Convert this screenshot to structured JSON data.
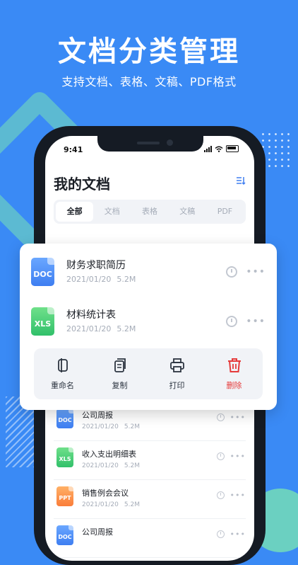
{
  "hero": {
    "title": "文档分类管理",
    "subtitle": "支持文档、表格、文稿、PDF格式"
  },
  "status": {
    "time": "9:41"
  },
  "page": {
    "title": "我的文档"
  },
  "tabs": [
    {
      "label": "全部",
      "active": true
    },
    {
      "label": "文档",
      "active": false
    },
    {
      "label": "表格",
      "active": false
    },
    {
      "label": "文稿",
      "active": false
    },
    {
      "label": "PDF",
      "active": false
    }
  ],
  "popup": {
    "files": [
      {
        "name": "财务求职简历",
        "date": "2021/01/20",
        "size": "5.2M",
        "type": "DOC"
      },
      {
        "name": "材料统计表",
        "date": "2021/01/20",
        "size": "5.2M",
        "type": "XLS"
      }
    ],
    "actions": [
      {
        "label": "重命名",
        "icon": "rename-icon"
      },
      {
        "label": "复制",
        "icon": "copy-icon"
      },
      {
        "label": "打印",
        "icon": "print-icon"
      },
      {
        "label": "删除",
        "icon": "trash-icon"
      }
    ]
  },
  "list": [
    {
      "name": "公司周报",
      "date": "2021/01/20",
      "size": "5.2M",
      "type": "DOC"
    },
    {
      "name": "收入支出明细表",
      "date": "2021/01/20",
      "size": "5.2M",
      "type": "XLS"
    },
    {
      "name": "销售例会会议",
      "date": "2021/01/20",
      "size": "5.2M",
      "type": "PPT"
    },
    {
      "name": "公司周报",
      "date": "",
      "size": "",
      "type": "DOC"
    }
  ],
  "colors": {
    "background": "#3a8af5",
    "doc": "#3e7ef1",
    "xls": "#31c06a",
    "ppt": "#fa7d3a",
    "delete": "#e53b3b"
  }
}
